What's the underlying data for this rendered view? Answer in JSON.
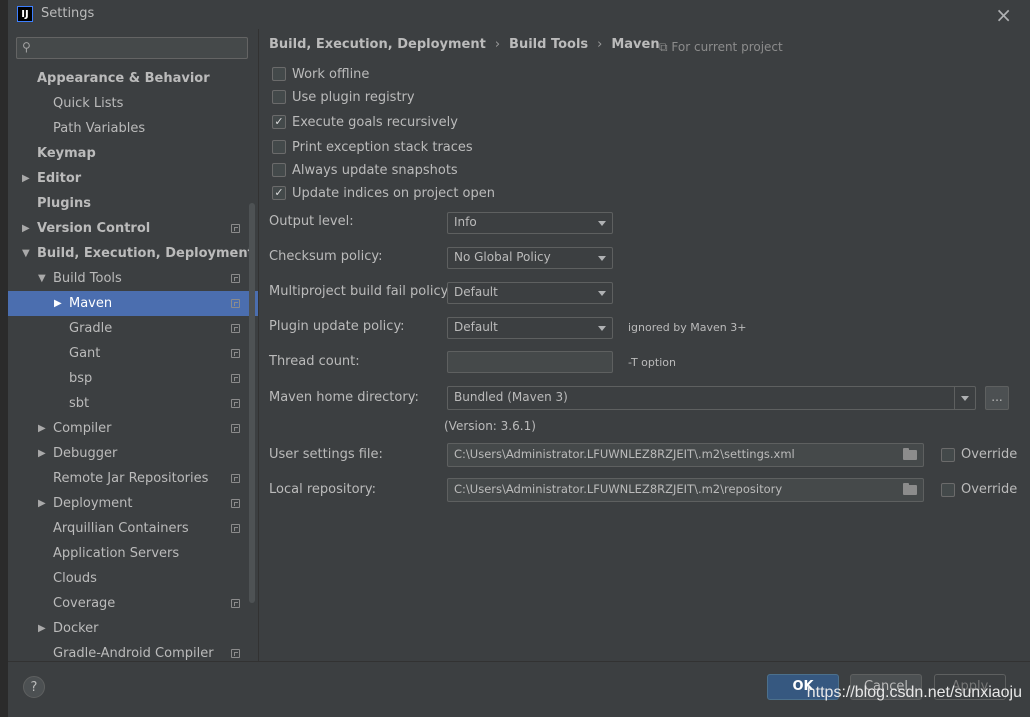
{
  "window": {
    "title": "Settings",
    "app_icon": "IJ"
  },
  "search": {
    "placeholder": ""
  },
  "sidebar": {
    "items": [
      {
        "label": "Appearance & Behavior",
        "bold": true,
        "indent": 0,
        "arrow": "",
        "project": false
      },
      {
        "label": "Quick Lists",
        "bold": false,
        "indent": 1,
        "arrow": "",
        "project": false
      },
      {
        "label": "Path Variables",
        "bold": false,
        "indent": 1,
        "arrow": "",
        "project": false
      },
      {
        "label": "Keymap",
        "bold": true,
        "indent": 0,
        "arrow": "",
        "project": false
      },
      {
        "label": "Editor",
        "bold": true,
        "indent": 0,
        "arrow": "▶",
        "project": false
      },
      {
        "label": "Plugins",
        "bold": true,
        "indent": 0,
        "arrow": "",
        "project": false
      },
      {
        "label": "Version Control",
        "bold": true,
        "indent": 0,
        "arrow": "▶",
        "project": true
      },
      {
        "label": "Build, Execution, Deployment",
        "bold": true,
        "indent": 0,
        "arrow": "▼",
        "project": false
      },
      {
        "label": "Build Tools",
        "bold": false,
        "indent": 1,
        "arrow": "▼",
        "project": true
      },
      {
        "label": "Maven",
        "bold": false,
        "indent": 2,
        "arrow": "▶",
        "project": true,
        "selected": true
      },
      {
        "label": "Gradle",
        "bold": false,
        "indent": 2,
        "arrow": "",
        "project": true
      },
      {
        "label": "Gant",
        "bold": false,
        "indent": 2,
        "arrow": "",
        "project": true
      },
      {
        "label": "bsp",
        "bold": false,
        "indent": 2,
        "arrow": "",
        "project": true
      },
      {
        "label": "sbt",
        "bold": false,
        "indent": 2,
        "arrow": "",
        "project": true
      },
      {
        "label": "Compiler",
        "bold": false,
        "indent": 1,
        "arrow": "▶",
        "project": true
      },
      {
        "label": "Debugger",
        "bold": false,
        "indent": 1,
        "arrow": "▶",
        "project": false
      },
      {
        "label": "Remote Jar Repositories",
        "bold": false,
        "indent": 1,
        "arrow": "",
        "project": true
      },
      {
        "label": "Deployment",
        "bold": false,
        "indent": 1,
        "arrow": "▶",
        "project": true
      },
      {
        "label": "Arquillian Containers",
        "bold": false,
        "indent": 1,
        "arrow": "",
        "project": true
      },
      {
        "label": "Application Servers",
        "bold": false,
        "indent": 1,
        "arrow": "",
        "project": false
      },
      {
        "label": "Clouds",
        "bold": false,
        "indent": 1,
        "arrow": "",
        "project": false
      },
      {
        "label": "Coverage",
        "bold": false,
        "indent": 1,
        "arrow": "",
        "project": true
      },
      {
        "label": "Docker",
        "bold": false,
        "indent": 1,
        "arrow": "▶",
        "project": false
      },
      {
        "label": "Gradle-Android Compiler",
        "bold": false,
        "indent": 1,
        "arrow": "",
        "project": true
      }
    ]
  },
  "breadcrumb": {
    "part1": "Build, Execution, Deployment",
    "part2": "Build Tools",
    "part3": "Maven",
    "separator": "›"
  },
  "scope_note": "For current project",
  "checkboxes": [
    {
      "label": "Work offline",
      "checked": false
    },
    {
      "label": "Use plugin registry",
      "checked": false
    },
    {
      "label": "Execute goals recursively",
      "checked": true
    },
    {
      "label": "Print exception stack traces",
      "checked": false
    },
    {
      "label": "Always update snapshots",
      "checked": false
    },
    {
      "label": "Update indices on project open",
      "checked": true
    }
  ],
  "form": {
    "output_level": {
      "label": "Output level:",
      "value": "Info"
    },
    "checksum_policy": {
      "label": "Checksum policy:",
      "value": "No Global Policy"
    },
    "multiproject_fail_policy": {
      "label": "Multiproject build fail policy:",
      "value": "Default"
    },
    "plugin_update_policy": {
      "label": "Plugin update policy:",
      "value": "Default",
      "hint": "ignored by Maven 3+"
    },
    "thread_count": {
      "label": "Thread count:",
      "value": "",
      "hint": "-T option"
    },
    "maven_home": {
      "label": "Maven home directory:",
      "value": "Bundled (Maven 3)",
      "browse": "..."
    },
    "version": "(Version: 3.6.1)",
    "user_settings": {
      "label": "User settings file:",
      "value": "C:\\Users\\Administrator.LFUWNLEZ8RZJEIT\\.m2\\settings.xml",
      "override_label": "Override",
      "override_checked": false
    },
    "local_repo": {
      "label": "Local repository:",
      "value": "C:\\Users\\Administrator.LFUWNLEZ8RZJEIT\\.m2\\repository",
      "override_label": "Override",
      "override_checked": false
    }
  },
  "footer": {
    "help": "?",
    "ok": "OK",
    "cancel": "Cancel",
    "apply": "Apply"
  },
  "watermark": "https://blog.csdn.net/sunxiaoju",
  "colors": {
    "selection": "#4b6eaf",
    "background": "#3c3f41",
    "ok_button": "#365880"
  }
}
